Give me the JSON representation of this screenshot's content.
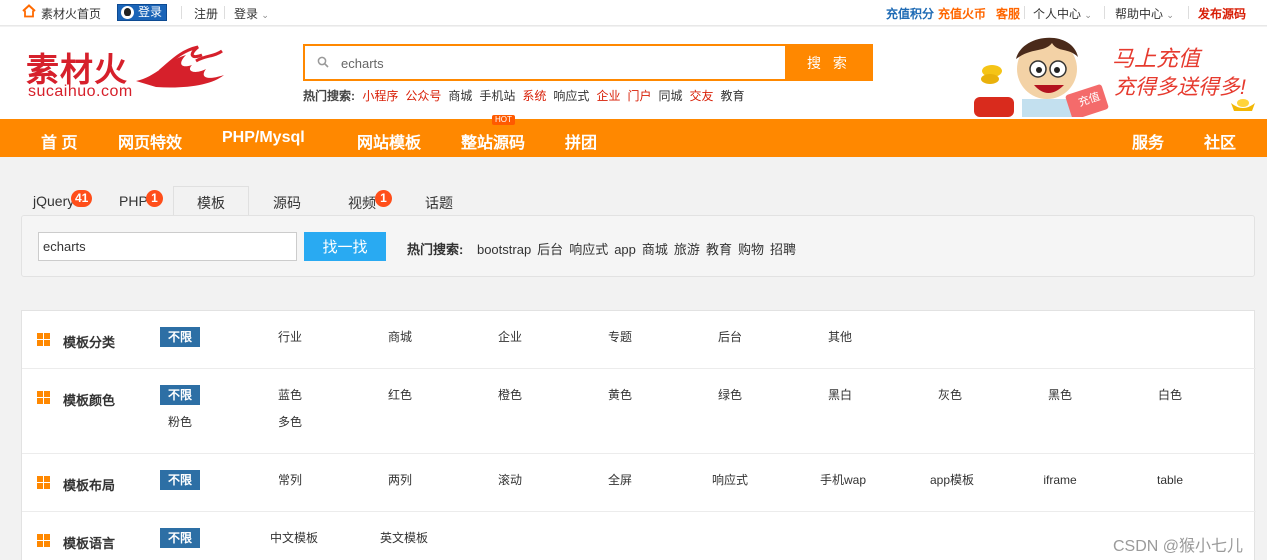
{
  "topbar": {
    "home": "素材火首页",
    "qq_login": "登录",
    "register": "注册",
    "login": "登录",
    "recharge_points": "充值积分",
    "recharge_coins": "充值火币",
    "service": "客服",
    "personal": "个人中心",
    "help": "帮助中心",
    "publish": "发布源码"
  },
  "logo": {
    "text": "素材火",
    "sub": "sucaihuo.com"
  },
  "search": {
    "value": "echarts",
    "button": "搜 索",
    "hot_label": "热门搜索:",
    "hot": [
      {
        "text": "小程序",
        "color": "#d81e06"
      },
      {
        "text": "公众号",
        "color": "#d81e06"
      },
      {
        "text": "商城",
        "color": "#333333"
      },
      {
        "text": "手机站",
        "color": "#333333"
      },
      {
        "text": "系统",
        "color": "#d81e06"
      },
      {
        "text": "响应式",
        "color": "#333333"
      },
      {
        "text": "企业",
        "color": "#d81e06"
      },
      {
        "text": "门户",
        "color": "#d81e06"
      },
      {
        "text": "同城",
        "color": "#333333"
      },
      {
        "text": "交友",
        "color": "#d81e06"
      },
      {
        "text": "教育",
        "color": "#333333"
      }
    ]
  },
  "promo": {
    "line1": "马上充值",
    "line2": "充得多送得多!",
    "stamp": "充值"
  },
  "nav": {
    "items": [
      "首 页",
      "网页特效",
      "PHP/Mysql",
      "网站模板",
      "整站源码",
      "拼团"
    ],
    "right": [
      "服务",
      "社区"
    ],
    "hot_tag": "HOT"
  },
  "tabs": [
    {
      "label": "jQuery",
      "badge": "41"
    },
    {
      "label": "PHP",
      "badge": "1"
    },
    {
      "label": "模板",
      "badge": ""
    },
    {
      "label": "源码",
      "badge": ""
    },
    {
      "label": "视频",
      "badge": "1"
    },
    {
      "label": "话题",
      "badge": ""
    }
  ],
  "subsearch": {
    "value": "echarts",
    "button": "找一找",
    "hot_label": "热门搜索:",
    "hot": [
      "bootstrap",
      "后台",
      "响应式",
      "app",
      "商城",
      "旅游",
      "教育",
      "购物",
      "招聘"
    ]
  },
  "filters": [
    {
      "label": "模板分类",
      "options": [
        "不限",
        "行业",
        "商城",
        "企业",
        "专题",
        "后台",
        "其他"
      ]
    },
    {
      "label": "模板颜色",
      "options": [
        "不限",
        "蓝色",
        "红色",
        "橙色",
        "黄色",
        "绿色",
        "黑白",
        "灰色",
        "黑色",
        "白色",
        "粉色",
        "多色"
      ]
    },
    {
      "label": "模板布局",
      "options": [
        "不限",
        "常列",
        "两列",
        "滚动",
        "全屏",
        "响应式",
        "手机wap",
        "app模板",
        "iframe",
        "table"
      ]
    },
    {
      "label": "模板语言",
      "options": [
        "不限",
        "中文模板",
        "英文模板"
      ]
    }
  ],
  "watermark": "CSDN @猴小七儿"
}
